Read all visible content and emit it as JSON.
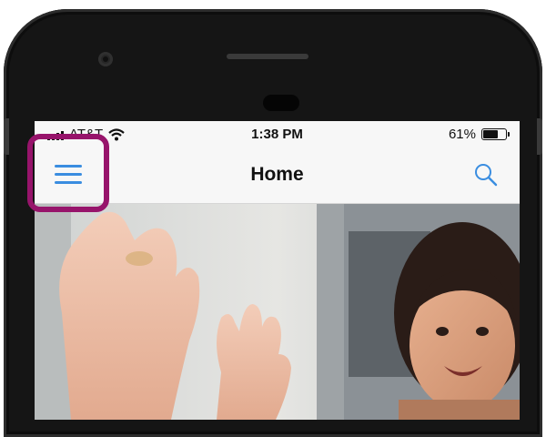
{
  "status": {
    "carrier": "AT&T",
    "time": "1:38 PM",
    "battery_percent": "61%",
    "battery_level": 0.61
  },
  "navbar": {
    "title": "Home",
    "menu_icon": "hamburger-menu-icon",
    "search_icon": "search-icon"
  },
  "hero": {
    "description_icon": "photo"
  },
  "colors": {
    "accent": "#3a8de0",
    "highlight": "#97146b",
    "phone_frame": "#151515"
  }
}
